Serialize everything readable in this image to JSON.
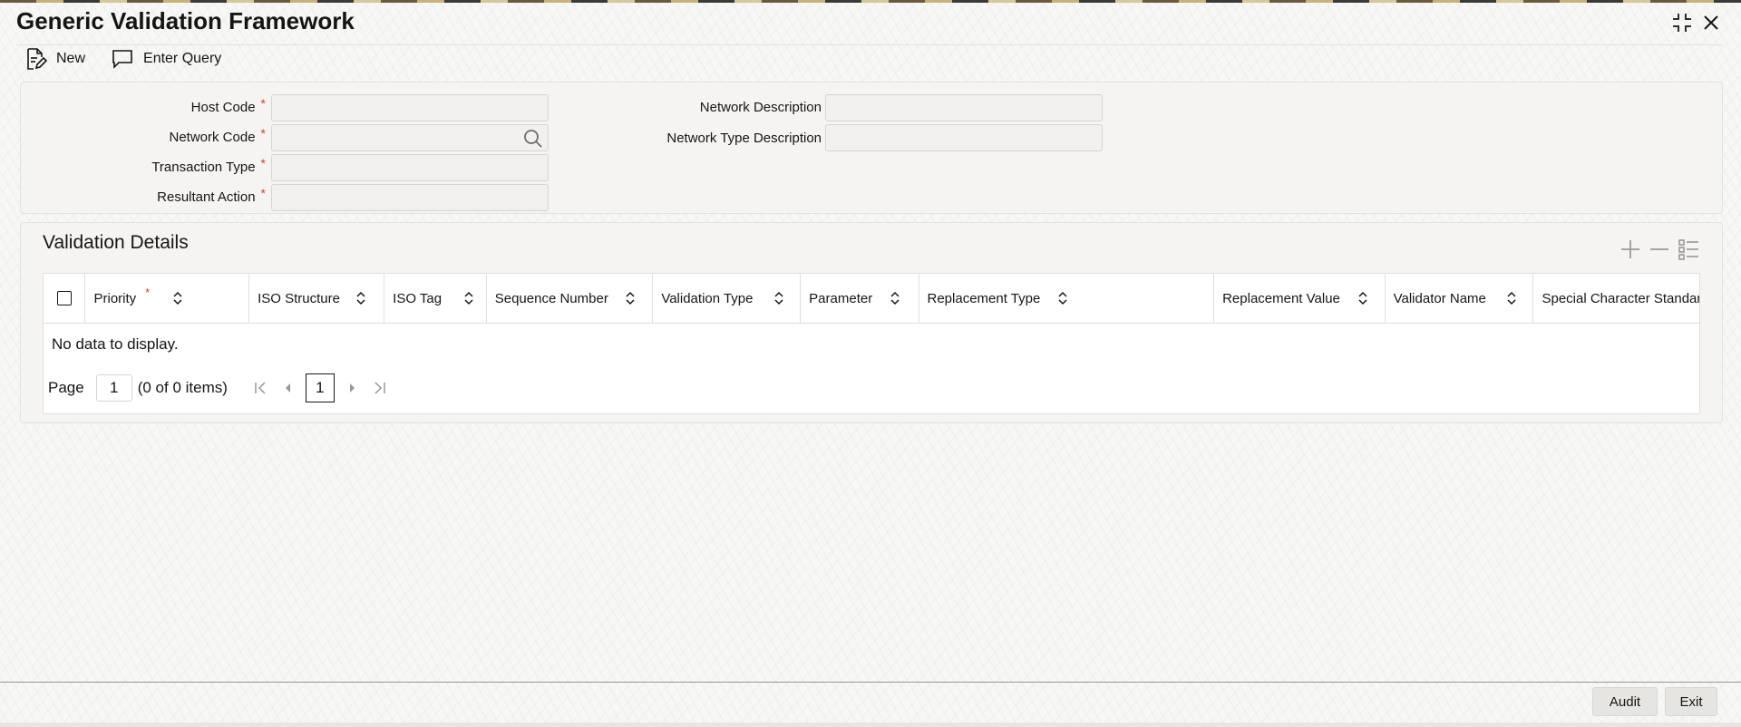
{
  "window": {
    "title": "Generic Validation Framework"
  },
  "toolbar": {
    "new_label": "New",
    "enter_query_label": "Enter Query"
  },
  "form": {
    "host_code_label": "Host Code",
    "network_code_label": "Network Code",
    "transaction_type_label": "Transaction Type",
    "resultant_action_label": "Resultant Action",
    "network_description_label": "Network Description",
    "network_type_description_label": "Network Type Description",
    "required_marker": "*",
    "host_code_value": "",
    "network_code_value": "",
    "transaction_type_value": "",
    "resultant_action_value": "",
    "network_description_value": "",
    "network_type_description_value": ""
  },
  "validation_details": {
    "title": "Validation Details",
    "columns": [
      "Priority",
      "ISO Structure",
      "ISO Tag",
      "Sequence Number",
      "Validation Type",
      "Parameter",
      "Replacement Type",
      "Replacement Value",
      "Validator Name",
      "Special Character Standard"
    ],
    "required_marker": "*",
    "no_data_text": "No data to display.",
    "pager": {
      "page_label": "Page",
      "page_input_value": "1",
      "items_text": "(0 of 0 items)",
      "current_page": "1"
    }
  },
  "footer": {
    "audit_label": "Audit",
    "exit_label": "Exit"
  },
  "colors": {
    "required": "#c74634",
    "panel_bg": "#f5f4f2",
    "button_bg": "#e7e5e1"
  }
}
